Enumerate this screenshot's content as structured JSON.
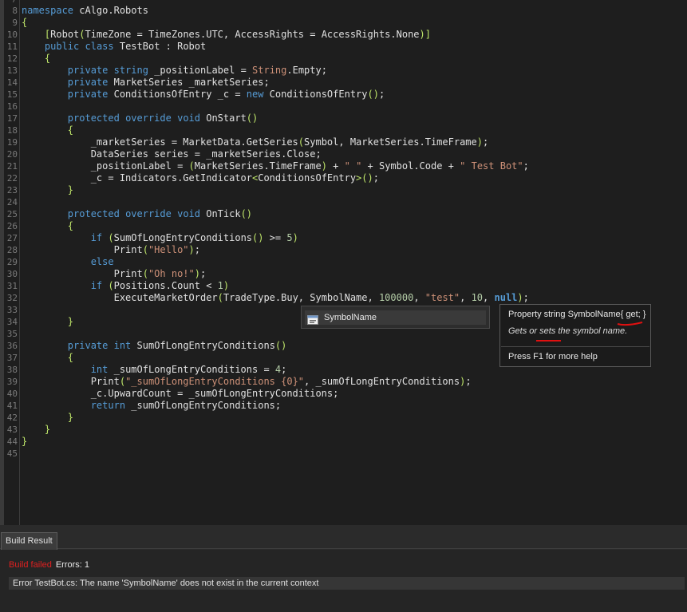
{
  "colors": {
    "background": "#1e1e1e",
    "keyword": "#569cd6",
    "string": "#ce9178",
    "number": "#b5cea8",
    "bracket": "#bfe66a",
    "error": "#e02020",
    "squiggle": "#e01010"
  },
  "editor": {
    "first_line_fragment": "/",
    "lines": [
      {
        "n": "8",
        "tokens": [
          {
            "t": "namespace",
            "c": "kw"
          },
          {
            "t": " cAlgo.Robots",
            "c": "id"
          }
        ]
      },
      {
        "n": "9",
        "tokens": [
          {
            "t": "{",
            "c": "br"
          }
        ]
      },
      {
        "n": "10",
        "tokens": [
          {
            "t": "    ",
            "c": "id"
          },
          {
            "t": "[",
            "c": "br"
          },
          {
            "t": "Robot",
            "c": "id"
          },
          {
            "t": "(",
            "c": "br"
          },
          {
            "t": "TimeZone = TimeZones.UTC, AccessRights = AccessRights.None",
            "c": "id"
          },
          {
            "t": ")",
            "c": "br"
          },
          {
            "t": "]",
            "c": "br"
          }
        ]
      },
      {
        "n": "11",
        "tokens": [
          {
            "t": "    ",
            "c": "id"
          },
          {
            "t": "public",
            "c": "kw"
          },
          {
            "t": " ",
            "c": "id"
          },
          {
            "t": "class",
            "c": "kw"
          },
          {
            "t": " TestBot : Robot",
            "c": "id"
          }
        ]
      },
      {
        "n": "12",
        "tokens": [
          {
            "t": "    ",
            "c": "id"
          },
          {
            "t": "{",
            "c": "br"
          }
        ]
      },
      {
        "n": "13",
        "tokens": [
          {
            "t": "        ",
            "c": "id"
          },
          {
            "t": "private",
            "c": "kw"
          },
          {
            "t": " ",
            "c": "id"
          },
          {
            "t": "string",
            "c": "kw"
          },
          {
            "t": " _positionLabel = ",
            "c": "id"
          },
          {
            "t": "String",
            "c": "str"
          },
          {
            "t": ".Empty;",
            "c": "id"
          }
        ]
      },
      {
        "n": "14",
        "tokens": [
          {
            "t": "        ",
            "c": "id"
          },
          {
            "t": "private",
            "c": "kw"
          },
          {
            "t": " MarketSeries _marketSeries;",
            "c": "id"
          }
        ]
      },
      {
        "n": "15",
        "tokens": [
          {
            "t": "        ",
            "c": "id"
          },
          {
            "t": "private",
            "c": "kw"
          },
          {
            "t": " ConditionsOfEntry _c = ",
            "c": "id"
          },
          {
            "t": "new",
            "c": "kw"
          },
          {
            "t": " ConditionsOfEntry",
            "c": "id"
          },
          {
            "t": "()",
            "c": "br"
          },
          {
            "t": ";",
            "c": "id"
          }
        ]
      },
      {
        "n": "16",
        "tokens": []
      },
      {
        "n": "17",
        "tokens": [
          {
            "t": "        ",
            "c": "id"
          },
          {
            "t": "protected",
            "c": "kw"
          },
          {
            "t": " ",
            "c": "id"
          },
          {
            "t": "override",
            "c": "kw"
          },
          {
            "t": " ",
            "c": "id"
          },
          {
            "t": "void",
            "c": "kw"
          },
          {
            "t": " OnStart",
            "c": "id"
          },
          {
            "t": "()",
            "c": "br"
          }
        ]
      },
      {
        "n": "18",
        "tokens": [
          {
            "t": "        ",
            "c": "id"
          },
          {
            "t": "{",
            "c": "br"
          }
        ]
      },
      {
        "n": "19",
        "tokens": [
          {
            "t": "            _marketSeries = MarketData.GetSeries",
            "c": "id"
          },
          {
            "t": "(",
            "c": "br"
          },
          {
            "t": "Symbol, MarketSeries.TimeFrame",
            "c": "id"
          },
          {
            "t": ")",
            "c": "br"
          },
          {
            "t": ";",
            "c": "id"
          }
        ]
      },
      {
        "n": "20",
        "tokens": [
          {
            "t": "            DataSeries series = _marketSeries.Close;",
            "c": "id"
          }
        ]
      },
      {
        "n": "21",
        "tokens": [
          {
            "t": "            _positionLabel = ",
            "c": "id"
          },
          {
            "t": "(",
            "c": "br"
          },
          {
            "t": "MarketSeries.TimeFrame",
            "c": "id"
          },
          {
            "t": ")",
            "c": "br"
          },
          {
            "t": " + ",
            "c": "id"
          },
          {
            "t": "\" \"",
            "c": "str"
          },
          {
            "t": " + Symbol.Code + ",
            "c": "id"
          },
          {
            "t": "\" Test Bot\"",
            "c": "str"
          },
          {
            "t": ";",
            "c": "id"
          }
        ]
      },
      {
        "n": "22",
        "tokens": [
          {
            "t": "            _c = Indicators.GetIndicator",
            "c": "id"
          },
          {
            "t": "<",
            "c": "br"
          },
          {
            "t": "ConditionsOfEntry",
            "c": "id"
          },
          {
            "t": ">",
            "c": "br"
          },
          {
            "t": "()",
            "c": "br"
          },
          {
            "t": ";",
            "c": "id"
          }
        ]
      },
      {
        "n": "23",
        "tokens": [
          {
            "t": "        ",
            "c": "id"
          },
          {
            "t": "}",
            "c": "br"
          }
        ]
      },
      {
        "n": "24",
        "tokens": []
      },
      {
        "n": "25",
        "tokens": [
          {
            "t": "        ",
            "c": "id"
          },
          {
            "t": "protected",
            "c": "kw"
          },
          {
            "t": " ",
            "c": "id"
          },
          {
            "t": "override",
            "c": "kw"
          },
          {
            "t": " ",
            "c": "id"
          },
          {
            "t": "void",
            "c": "kw"
          },
          {
            "t": " OnTick",
            "c": "id"
          },
          {
            "t": "()",
            "c": "br"
          }
        ]
      },
      {
        "n": "26",
        "tokens": [
          {
            "t": "        ",
            "c": "id"
          },
          {
            "t": "{",
            "c": "br"
          }
        ]
      },
      {
        "n": "27",
        "tokens": [
          {
            "t": "            ",
            "c": "id"
          },
          {
            "t": "if",
            "c": "kw"
          },
          {
            "t": " ",
            "c": "id"
          },
          {
            "t": "(",
            "c": "br"
          },
          {
            "t": "SumOfLongEntryConditions",
            "c": "id"
          },
          {
            "t": "()",
            "c": "br"
          },
          {
            "t": " >= ",
            "c": "id"
          },
          {
            "t": "5",
            "c": "num"
          },
          {
            "t": ")",
            "c": "br"
          }
        ]
      },
      {
        "n": "28",
        "tokens": [
          {
            "t": "                Print",
            "c": "id"
          },
          {
            "t": "(",
            "c": "br"
          },
          {
            "t": "\"Hello\"",
            "c": "str"
          },
          {
            "t": ")",
            "c": "br"
          },
          {
            "t": ";",
            "c": "id"
          }
        ]
      },
      {
        "n": "29",
        "tokens": [
          {
            "t": "            ",
            "c": "id"
          },
          {
            "t": "else",
            "c": "kw"
          }
        ]
      },
      {
        "n": "30",
        "tokens": [
          {
            "t": "                Print",
            "c": "id"
          },
          {
            "t": "(",
            "c": "br"
          },
          {
            "t": "\"Oh no!\"",
            "c": "str"
          },
          {
            "t": ")",
            "c": "br"
          },
          {
            "t": ";",
            "c": "id"
          }
        ]
      },
      {
        "n": "31",
        "tokens": [
          {
            "t": "            ",
            "c": "id"
          },
          {
            "t": "if",
            "c": "kw"
          },
          {
            "t": " ",
            "c": "id"
          },
          {
            "t": "(",
            "c": "br"
          },
          {
            "t": "Positions.Count < ",
            "c": "id"
          },
          {
            "t": "1",
            "c": "num"
          },
          {
            "t": ")",
            "c": "br"
          }
        ]
      },
      {
        "n": "32",
        "tokens": [
          {
            "t": "                ExecuteMarketOrder",
            "c": "id"
          },
          {
            "t": "(",
            "c": "br"
          },
          {
            "t": "TradeType.Buy, SymbolName, ",
            "c": "id"
          },
          {
            "t": "100000",
            "c": "num"
          },
          {
            "t": ", ",
            "c": "id"
          },
          {
            "t": "\"test\"",
            "c": "str"
          },
          {
            "t": ", ",
            "c": "id"
          },
          {
            "t": "10",
            "c": "num"
          },
          {
            "t": ", ",
            "c": "id"
          },
          {
            "t": "null",
            "c": "kwb"
          },
          {
            "t": ")",
            "c": "br"
          },
          {
            "t": ";",
            "c": "id"
          }
        ]
      },
      {
        "n": "33",
        "tokens": []
      },
      {
        "n": "34",
        "tokens": [
          {
            "t": "        ",
            "c": "id"
          },
          {
            "t": "}",
            "c": "br"
          }
        ]
      },
      {
        "n": "35",
        "tokens": []
      },
      {
        "n": "36",
        "tokens": [
          {
            "t": "        ",
            "c": "id"
          },
          {
            "t": "private",
            "c": "kw"
          },
          {
            "t": " ",
            "c": "id"
          },
          {
            "t": "int",
            "c": "kw"
          },
          {
            "t": " SumOfLongEntryConditions",
            "c": "id"
          },
          {
            "t": "()",
            "c": "br"
          }
        ]
      },
      {
        "n": "37",
        "tokens": [
          {
            "t": "        ",
            "c": "id"
          },
          {
            "t": "{",
            "c": "br"
          }
        ]
      },
      {
        "n": "38",
        "tokens": [
          {
            "t": "            ",
            "c": "id"
          },
          {
            "t": "int",
            "c": "kw"
          },
          {
            "t": " _sumOfLongEntryConditions = ",
            "c": "id"
          },
          {
            "t": "4",
            "c": "num"
          },
          {
            "t": ";",
            "c": "id"
          }
        ]
      },
      {
        "n": "39",
        "tokens": [
          {
            "t": "            Print",
            "c": "id"
          },
          {
            "t": "(",
            "c": "br"
          },
          {
            "t": "\"_sumOfLongEntryConditions {0}\"",
            "c": "str"
          },
          {
            "t": ", _sumOfLongEntryConditions",
            "c": "id"
          },
          {
            "t": ")",
            "c": "br"
          },
          {
            "t": ";",
            "c": "id"
          }
        ]
      },
      {
        "n": "40",
        "tokens": [
          {
            "t": "            _c.UpwardCount = _sumOfLongEntryConditions;",
            "c": "id"
          }
        ]
      },
      {
        "n": "41",
        "tokens": [
          {
            "t": "            ",
            "c": "id"
          },
          {
            "t": "return",
            "c": "kw"
          },
          {
            "t": " _sumOfLongEntryConditions;",
            "c": "id"
          }
        ]
      },
      {
        "n": "42",
        "tokens": [
          {
            "t": "        ",
            "c": "id"
          },
          {
            "t": "}",
            "c": "br"
          }
        ]
      },
      {
        "n": "43",
        "tokens": [
          {
            "t": "    ",
            "c": "id"
          },
          {
            "t": "}",
            "c": "br"
          }
        ]
      },
      {
        "n": "44",
        "tokens": [
          {
            "t": "}",
            "c": "br"
          }
        ]
      },
      {
        "n": "45",
        "tokens": []
      }
    ]
  },
  "completion": {
    "icon": "property-icon",
    "item_label": "SymbolName"
  },
  "tooltip": {
    "signature": "Property string SymbolName{ get; }",
    "description": "Gets or sets the symbol name.",
    "help": "Press F1 for more help"
  },
  "build_panel": {
    "tab_label": "Build Result",
    "status": "Build failed",
    "errors": "Errors: 1",
    "error_message": "Error TestBot.cs: The name 'SymbolName' does not exist in the current context"
  }
}
